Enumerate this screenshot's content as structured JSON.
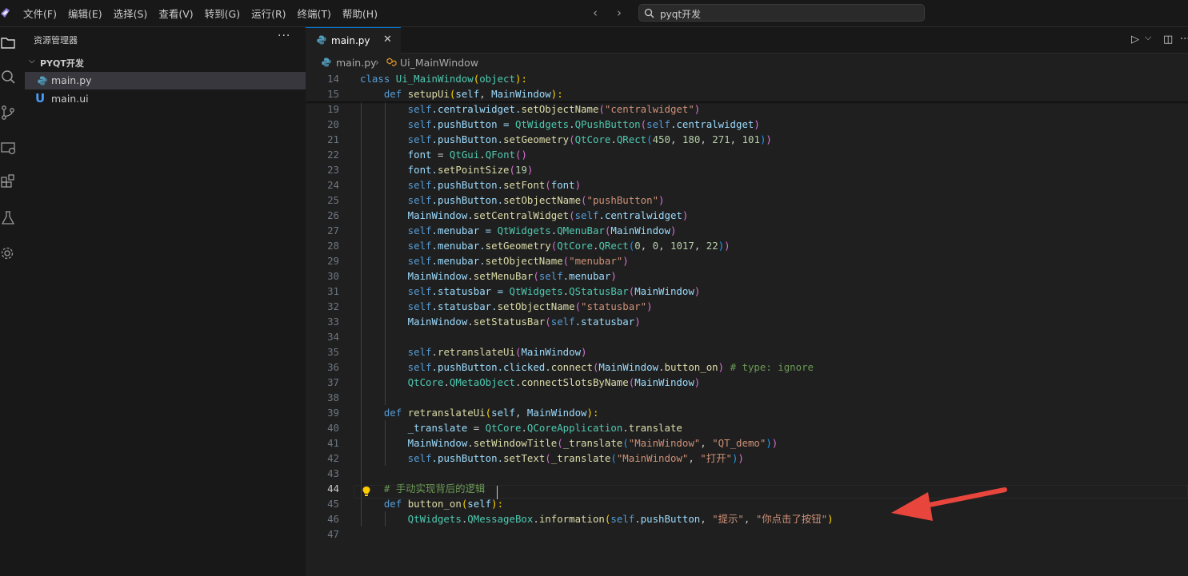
{
  "menu": [
    "文件(F)",
    "编辑(E)",
    "选择(S)",
    "查看(V)",
    "转到(G)",
    "运行(R)",
    "终端(T)",
    "帮助(H)"
  ],
  "nav": {
    "back": "‹",
    "forward": "›"
  },
  "search": {
    "text": "pyqt开发"
  },
  "sidebar": {
    "title": "资源管理器",
    "more": "···",
    "folder": "PYQT开发",
    "files": [
      {
        "name": "main.py",
        "icon": "python-file-icon",
        "active": true
      },
      {
        "name": "main.ui",
        "icon": "u-file-icon",
        "active": false
      }
    ]
  },
  "tab": {
    "label": "main.py",
    "close": "✕"
  },
  "editor_actions": {
    "run": "▷",
    "run_menu": "⌵",
    "split": "◫",
    "more": "···"
  },
  "breadcrumb": {
    "file": "main.py",
    "symbol": "Ui_MainWindow"
  },
  "code": {
    "current_line": "44",
    "lines": [
      {
        "n": "14",
        "t": [
          [
            "class ",
            "#569cd6"
          ],
          [
            "Ui_MainWindow",
            "#4ec9b0"
          ],
          [
            "(",
            "#ffd700"
          ],
          [
            "object",
            "#4ec9b0"
          ],
          [
            "):",
            "#ffd700"
          ]
        ]
      },
      {
        "n": "15",
        "t": [
          [
            "    def ",
            "#569cd6"
          ],
          [
            "setupUi",
            "#dcdcaa"
          ],
          [
            "(",
            "#ffd700"
          ],
          [
            "self",
            "#9cdcfe"
          ],
          [
            ", ",
            "#cccccc"
          ],
          [
            "MainWindow",
            "#9cdcfe"
          ],
          [
            "):",
            "#ffd700"
          ]
        ]
      },
      {
        "n": "19",
        "t": [
          [
            "        self",
            "#569cd6"
          ],
          [
            ".centralwidget.",
            "#9cdcfe"
          ],
          [
            "setObjectName",
            "#dcdcaa"
          ],
          [
            "(",
            "#da70d6"
          ],
          [
            "\"centralwidget\"",
            "#ce9178"
          ],
          [
            ")",
            "#da70d6"
          ]
        ]
      },
      {
        "n": "20",
        "t": [
          [
            "        self",
            "#569cd6"
          ],
          [
            ".pushButton = ",
            "#9cdcfe"
          ],
          [
            "QtWidgets",
            "#4ec9b0"
          ],
          [
            ".",
            "#cccccc"
          ],
          [
            "QPushButton",
            "#4ec9b0"
          ],
          [
            "(",
            "#da70d6"
          ],
          [
            "self",
            "#569cd6"
          ],
          [
            ".centralwidget",
            "#9cdcfe"
          ],
          [
            ")",
            "#da70d6"
          ]
        ]
      },
      {
        "n": "21",
        "t": [
          [
            "        self",
            "#569cd6"
          ],
          [
            ".pushButton.",
            "#9cdcfe"
          ],
          [
            "setGeometry",
            "#dcdcaa"
          ],
          [
            "(",
            "#da70d6"
          ],
          [
            "QtCore",
            "#4ec9b0"
          ],
          [
            ".",
            "#cccccc"
          ],
          [
            "QRect",
            "#4ec9b0"
          ],
          [
            "(",
            "#179fff"
          ],
          [
            "450",
            "#b5cea8"
          ],
          [
            ", ",
            "#cccccc"
          ],
          [
            "180",
            "#b5cea8"
          ],
          [
            ", ",
            "#cccccc"
          ],
          [
            "271",
            "#b5cea8"
          ],
          [
            ", ",
            "#cccccc"
          ],
          [
            "101",
            "#b5cea8"
          ],
          [
            ")",
            "#179fff"
          ],
          [
            ")",
            "#da70d6"
          ]
        ]
      },
      {
        "n": "22",
        "t": [
          [
            "        font",
            "#9cdcfe"
          ],
          [
            " = ",
            "#cccccc"
          ],
          [
            "QtGui",
            "#4ec9b0"
          ],
          [
            ".",
            "#cccccc"
          ],
          [
            "QFont",
            "#4ec9b0"
          ],
          [
            "()",
            "#da70d6"
          ]
        ]
      },
      {
        "n": "23",
        "t": [
          [
            "        font.",
            "#9cdcfe"
          ],
          [
            "setPointSize",
            "#dcdcaa"
          ],
          [
            "(",
            "#da70d6"
          ],
          [
            "19",
            "#b5cea8"
          ],
          [
            ")",
            "#da70d6"
          ]
        ]
      },
      {
        "n": "24",
        "t": [
          [
            "        self",
            "#569cd6"
          ],
          [
            ".pushButton.",
            "#9cdcfe"
          ],
          [
            "setFont",
            "#dcdcaa"
          ],
          [
            "(",
            "#da70d6"
          ],
          [
            "font",
            "#9cdcfe"
          ],
          [
            ")",
            "#da70d6"
          ]
        ]
      },
      {
        "n": "25",
        "t": [
          [
            "        self",
            "#569cd6"
          ],
          [
            ".pushButton.",
            "#9cdcfe"
          ],
          [
            "setObjectName",
            "#dcdcaa"
          ],
          [
            "(",
            "#da70d6"
          ],
          [
            "\"pushButton\"",
            "#ce9178"
          ],
          [
            ")",
            "#da70d6"
          ]
        ]
      },
      {
        "n": "26",
        "t": [
          [
            "        MainWindow",
            "#9cdcfe"
          ],
          [
            ".",
            "#cccccc"
          ],
          [
            "setCentralWidget",
            "#dcdcaa"
          ],
          [
            "(",
            "#da70d6"
          ],
          [
            "self",
            "#569cd6"
          ],
          [
            ".centralwidget",
            "#9cdcfe"
          ],
          [
            ")",
            "#da70d6"
          ]
        ]
      },
      {
        "n": "27",
        "t": [
          [
            "        self",
            "#569cd6"
          ],
          [
            ".menubar = ",
            "#9cdcfe"
          ],
          [
            "QtWidgets",
            "#4ec9b0"
          ],
          [
            ".",
            "#cccccc"
          ],
          [
            "QMenuBar",
            "#4ec9b0"
          ],
          [
            "(",
            "#da70d6"
          ],
          [
            "MainWindow",
            "#9cdcfe"
          ],
          [
            ")",
            "#da70d6"
          ]
        ]
      },
      {
        "n": "28",
        "t": [
          [
            "        self",
            "#569cd6"
          ],
          [
            ".menubar.",
            "#9cdcfe"
          ],
          [
            "setGeometry",
            "#dcdcaa"
          ],
          [
            "(",
            "#da70d6"
          ],
          [
            "QtCore",
            "#4ec9b0"
          ],
          [
            ".",
            "#cccccc"
          ],
          [
            "QRect",
            "#4ec9b0"
          ],
          [
            "(",
            "#179fff"
          ],
          [
            "0",
            "#b5cea8"
          ],
          [
            ", ",
            "#cccccc"
          ],
          [
            "0",
            "#b5cea8"
          ],
          [
            ", ",
            "#cccccc"
          ],
          [
            "1017",
            "#b5cea8"
          ],
          [
            ", ",
            "#cccccc"
          ],
          [
            "22",
            "#b5cea8"
          ],
          [
            ")",
            "#179fff"
          ],
          [
            ")",
            "#da70d6"
          ]
        ]
      },
      {
        "n": "29",
        "t": [
          [
            "        self",
            "#569cd6"
          ],
          [
            ".menubar.",
            "#9cdcfe"
          ],
          [
            "setObjectName",
            "#dcdcaa"
          ],
          [
            "(",
            "#da70d6"
          ],
          [
            "\"menubar\"",
            "#ce9178"
          ],
          [
            ")",
            "#da70d6"
          ]
        ]
      },
      {
        "n": "30",
        "t": [
          [
            "        MainWindow",
            "#9cdcfe"
          ],
          [
            ".",
            "#cccccc"
          ],
          [
            "setMenuBar",
            "#dcdcaa"
          ],
          [
            "(",
            "#da70d6"
          ],
          [
            "self",
            "#569cd6"
          ],
          [
            ".menubar",
            "#9cdcfe"
          ],
          [
            ")",
            "#da70d6"
          ]
        ]
      },
      {
        "n": "31",
        "t": [
          [
            "        self",
            "#569cd6"
          ],
          [
            ".statusbar = ",
            "#9cdcfe"
          ],
          [
            "QtWidgets",
            "#4ec9b0"
          ],
          [
            ".",
            "#cccccc"
          ],
          [
            "QStatusBar",
            "#4ec9b0"
          ],
          [
            "(",
            "#da70d6"
          ],
          [
            "MainWindow",
            "#9cdcfe"
          ],
          [
            ")",
            "#da70d6"
          ]
        ]
      },
      {
        "n": "32",
        "t": [
          [
            "        self",
            "#569cd6"
          ],
          [
            ".statusbar.",
            "#9cdcfe"
          ],
          [
            "setObjectName",
            "#dcdcaa"
          ],
          [
            "(",
            "#da70d6"
          ],
          [
            "\"statusbar\"",
            "#ce9178"
          ],
          [
            ")",
            "#da70d6"
          ]
        ]
      },
      {
        "n": "33",
        "t": [
          [
            "        MainWindow",
            "#9cdcfe"
          ],
          [
            ".",
            "#cccccc"
          ],
          [
            "setStatusBar",
            "#dcdcaa"
          ],
          [
            "(",
            "#da70d6"
          ],
          [
            "self",
            "#569cd6"
          ],
          [
            ".statusbar",
            "#9cdcfe"
          ],
          [
            ")",
            "#da70d6"
          ]
        ]
      },
      {
        "n": "34",
        "t": []
      },
      {
        "n": "35",
        "t": [
          [
            "        self",
            "#569cd6"
          ],
          [
            ".",
            "#cccccc"
          ],
          [
            "retranslateUi",
            "#dcdcaa"
          ],
          [
            "(",
            "#da70d6"
          ],
          [
            "MainWindow",
            "#9cdcfe"
          ],
          [
            ")",
            "#da70d6"
          ]
        ]
      },
      {
        "n": "36",
        "t": [
          [
            "        self",
            "#569cd6"
          ],
          [
            ".pushButton.clicked.",
            "#9cdcfe"
          ],
          [
            "connect",
            "#dcdcaa"
          ],
          [
            "(",
            "#da70d6"
          ],
          [
            "MainWindow",
            "#9cdcfe"
          ],
          [
            ".",
            "#cccccc"
          ],
          [
            "button_on",
            "#dcdcaa"
          ],
          [
            ")",
            "#da70d6"
          ],
          [
            " # type: ignore",
            "#6a9955"
          ]
        ]
      },
      {
        "n": "37",
        "t": [
          [
            "        QtCore",
            "#4ec9b0"
          ],
          [
            ".",
            "#cccccc"
          ],
          [
            "QMetaObject",
            "#4ec9b0"
          ],
          [
            ".",
            "#cccccc"
          ],
          [
            "connectSlotsByName",
            "#dcdcaa"
          ],
          [
            "(",
            "#da70d6"
          ],
          [
            "MainWindow",
            "#9cdcfe"
          ],
          [
            ")",
            "#da70d6"
          ]
        ]
      },
      {
        "n": "38",
        "t": []
      },
      {
        "n": "39",
        "t": [
          [
            "    def ",
            "#569cd6"
          ],
          [
            "retranslateUi",
            "#dcdcaa"
          ],
          [
            "(",
            "#ffd700"
          ],
          [
            "self",
            "#9cdcfe"
          ],
          [
            ", ",
            "#cccccc"
          ],
          [
            "MainWindow",
            "#9cdcfe"
          ],
          [
            "):",
            "#ffd700"
          ]
        ]
      },
      {
        "n": "40",
        "t": [
          [
            "        _translate",
            "#9cdcfe"
          ],
          [
            " = ",
            "#cccccc"
          ],
          [
            "QtCore",
            "#4ec9b0"
          ],
          [
            ".",
            "#cccccc"
          ],
          [
            "QCoreApplication",
            "#4ec9b0"
          ],
          [
            ".",
            "#cccccc"
          ],
          [
            "translate",
            "#dcdcaa"
          ]
        ]
      },
      {
        "n": "41",
        "t": [
          [
            "        MainWindow",
            "#9cdcfe"
          ],
          [
            ".",
            "#cccccc"
          ],
          [
            "setWindowTitle",
            "#dcdcaa"
          ],
          [
            "(",
            "#da70d6"
          ],
          [
            "_translate",
            "#dcdcaa"
          ],
          [
            "(",
            "#179fff"
          ],
          [
            "\"MainWindow\"",
            "#ce9178"
          ],
          [
            ", ",
            "#cccccc"
          ],
          [
            "\"QT_demo\"",
            "#ce9178"
          ],
          [
            ")",
            "#179fff"
          ],
          [
            ")",
            "#da70d6"
          ]
        ]
      },
      {
        "n": "42",
        "t": [
          [
            "        self",
            "#569cd6"
          ],
          [
            ".pushButton.",
            "#9cdcfe"
          ],
          [
            "setText",
            "#dcdcaa"
          ],
          [
            "(",
            "#da70d6"
          ],
          [
            "_translate",
            "#dcdcaa"
          ],
          [
            "(",
            "#179fff"
          ],
          [
            "\"MainWindow\"",
            "#ce9178"
          ],
          [
            ", ",
            "#cccccc"
          ],
          [
            "\"打开\"",
            "#ce9178"
          ],
          [
            ")",
            "#179fff"
          ],
          [
            ")",
            "#da70d6"
          ]
        ]
      },
      {
        "n": "43",
        "t": []
      },
      {
        "n": "44",
        "t": [
          [
            "    # 手动实现背后的逻辑",
            "#6a9955"
          ]
        ]
      },
      {
        "n": "45",
        "t": [
          [
            "    def ",
            "#569cd6"
          ],
          [
            "button_on",
            "#dcdcaa"
          ],
          [
            "(",
            "#ffd700"
          ],
          [
            "self",
            "#9cdcfe"
          ],
          [
            "):",
            "#ffd700"
          ]
        ]
      },
      {
        "n": "46",
        "t": [
          [
            "        QtWidgets",
            "#4ec9b0"
          ],
          [
            ".",
            "#cccccc"
          ],
          [
            "QMessageBox",
            "#4ec9b0"
          ],
          [
            ".",
            "#cccccc"
          ],
          [
            "information",
            "#dcdcaa"
          ],
          [
            "(",
            "#ffd700"
          ],
          [
            "self",
            "#569cd6"
          ],
          [
            ".pushButton",
            "#9cdcfe"
          ],
          [
            ", ",
            "#cccccc"
          ],
          [
            "\"提示\"",
            "#ce9178"
          ],
          [
            ", ",
            "#cccccc"
          ],
          [
            "\"你点击了按钮\"",
            "#ce9178"
          ],
          [
            ")",
            "#ffd700"
          ]
        ]
      },
      {
        "n": "47",
        "t": []
      }
    ]
  },
  "colors": {
    "accent": "#0078d4",
    "arrow": "#e8453c",
    "bulb": "#ffcc00"
  }
}
